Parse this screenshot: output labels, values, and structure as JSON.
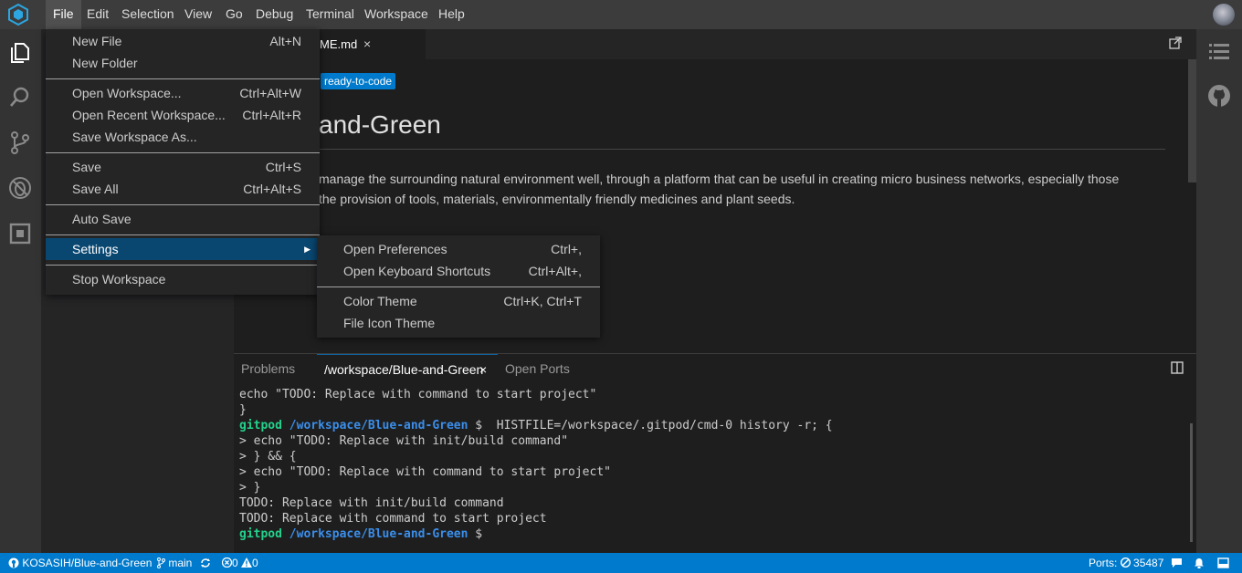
{
  "menubar": {
    "items": [
      "File",
      "Edit",
      "Selection",
      "View",
      "Go",
      "Debug",
      "Terminal",
      "Workspace",
      "Help"
    ]
  },
  "icons": {
    "logo": "gitpod-logo-icon",
    "activity": [
      "explorer-icon",
      "search-icon",
      "source-control-icon",
      "debug-icon",
      "extensions-icon"
    ],
    "right": [
      "outline-icon",
      "github-icon"
    ]
  },
  "editor": {
    "tab": {
      "label": "ME.md",
      "close": "×"
    },
    "badge": "ready-to-code",
    "heading": "and-Green",
    "paragraph_line1": "manage the surrounding natural environment well, through a platform that can be useful in creating micro business networks, especially those",
    "paragraph_line2": "the provision of tools, materials, environmentally friendly medicines and plant seeds."
  },
  "file_menu": {
    "new_file": {
      "label": "New File",
      "key": "Alt+N"
    },
    "new_folder": {
      "label": "New Folder",
      "key": ""
    },
    "open_workspace": {
      "label": "Open Workspace...",
      "key": "Ctrl+Alt+W"
    },
    "open_recent": {
      "label": "Open Recent Workspace...",
      "key": "Ctrl+Alt+R"
    },
    "save_workspace_as": {
      "label": "Save Workspace As...",
      "key": ""
    },
    "save": {
      "label": "Save",
      "key": "Ctrl+S"
    },
    "save_all": {
      "label": "Save All",
      "key": "Ctrl+Alt+S"
    },
    "auto_save": {
      "label": "Auto Save",
      "key": ""
    },
    "settings": {
      "label": "Settings",
      "arrow": "▶"
    },
    "stop_workspace": {
      "label": "Stop Workspace",
      "key": ""
    }
  },
  "settings_submenu": {
    "open_preferences": {
      "label": "Open Preferences",
      "key": "Ctrl+,"
    },
    "open_keyboard_shortcuts": {
      "label": "Open Keyboard Shortcuts",
      "key": "Ctrl+Alt+,"
    },
    "color_theme": {
      "label": "Color Theme",
      "key": "Ctrl+K, Ctrl+T"
    },
    "file_icon_theme": {
      "label": "File Icon Theme",
      "key": ""
    }
  },
  "panel": {
    "tabs": [
      "Problems",
      "/workspace/Blue-and-Green",
      "Open Ports"
    ],
    "close": "×",
    "terminal": {
      "line1": "echo \"TODO: Replace with command to start project\"",
      "line2": "}",
      "prompt_user": "gitpod",
      "prompt_path": "/workspace/Blue-and-Green",
      "prompt_symbol": "$",
      "line3_cmd": "  HISTFILE=/workspace/.gitpod/cmd-0 history -r; {",
      "line4": "> echo \"TODO: Replace with init/build command\"",
      "line5": "> } && {",
      "line6": "> echo \"TODO: Replace with command to start project\"",
      "line7": "> }",
      "line8": "TODO: Replace with init/build command",
      "line9": "TODO: Replace with command to start project"
    }
  },
  "statusbar": {
    "repo": "KOSASIH/Blue-and-Green",
    "branch": "main",
    "errors": "0",
    "warnings": "0",
    "ports_label": "Ports:",
    "ports_count": "35487"
  },
  "colors": {
    "accent": "#007acc",
    "menu_highlight": "#094771",
    "terminal_green": "#23d18b",
    "terminal_blue": "#3b8eea"
  }
}
